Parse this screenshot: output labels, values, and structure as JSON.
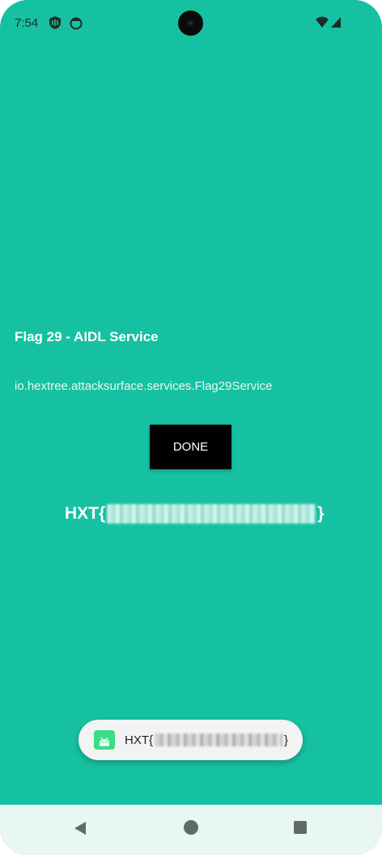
{
  "status_bar": {
    "time": "7:54",
    "icons": [
      "shield-app-icon",
      "notification-face-icon",
      "wifi-icon",
      "cellular-signal-icon",
      "camera-cutout"
    ]
  },
  "screen": {
    "heading": "Flag 29 - AIDL Service",
    "service_name": "io.hextree.attacksurface.services.Flag29Service",
    "done_button_label": "DONE",
    "flag_prefix": "HXT{",
    "flag_suffix": "}"
  },
  "toast": {
    "icon": "android-app-icon",
    "prefix": "HXT{",
    "suffix": "}"
  },
  "nav_bar": {
    "buttons": [
      "back-icon",
      "home-icon",
      "recents-icon"
    ]
  },
  "colors": {
    "background": "#16c1a2",
    "button": "#000000",
    "toast_background": "#f2f4f4",
    "nav_bar": "#e8f7f4"
  }
}
